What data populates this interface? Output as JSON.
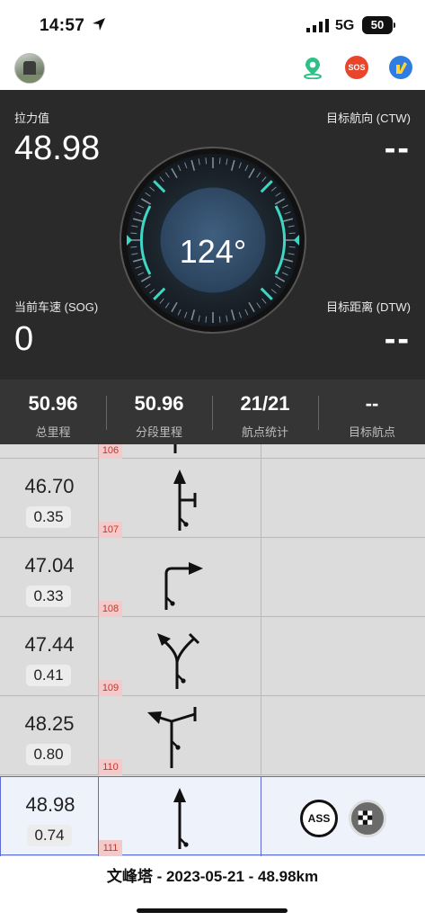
{
  "status_bar": {
    "time": "14:57",
    "network": "5G",
    "battery": "50"
  },
  "header": {
    "icons": [
      "avatar",
      "map-pin-icon",
      "sos-icon",
      "share-icon"
    ],
    "sos_label": "SOS"
  },
  "dashboard": {
    "pull_label": "拉力值",
    "pull_value": "48.98",
    "ctw_label": "目标航向 (CTW)",
    "ctw_value": "--",
    "sog_label": "当前车速 (SOG)",
    "sog_value": "0",
    "dtw_label": "目标距离 (DTW)",
    "dtw_value": "--",
    "heading": "124°",
    "colors": {
      "accent": "#3fd6c4",
      "dial_inner": "#34506c",
      "panel": "#2a2a2a"
    }
  },
  "stats": [
    {
      "value": "50.96",
      "label": "总里程"
    },
    {
      "value": "50.96",
      "label": "分段里程"
    },
    {
      "value": "21/21",
      "label": "航点统计"
    },
    {
      "value": "--",
      "label": "目标航点"
    }
  ],
  "roadbook": {
    "rows": [
      {
        "distance": "",
        "segment": "",
        "number": "106",
        "turn": "straight-partial"
      },
      {
        "distance": "46.70",
        "segment": "0.35",
        "number": "107",
        "turn": "straight-with-right-junction"
      },
      {
        "distance": "47.04",
        "segment": "0.33",
        "number": "108",
        "turn": "right-turn"
      },
      {
        "distance": "47.44",
        "segment": "0.41",
        "number": "109",
        "turn": "keep-left-fork"
      },
      {
        "distance": "48.25",
        "segment": "0.80",
        "number": "110",
        "turn": "left-turn-with-junction"
      },
      {
        "distance": "48.98",
        "segment": "0.74",
        "number": "111",
        "turn": "straight",
        "badges": [
          "ASS",
          "finish-flag-icon"
        ]
      }
    ]
  },
  "footer": {
    "summary": "文峰塔 - 2023-05-21 - 48.98km"
  }
}
